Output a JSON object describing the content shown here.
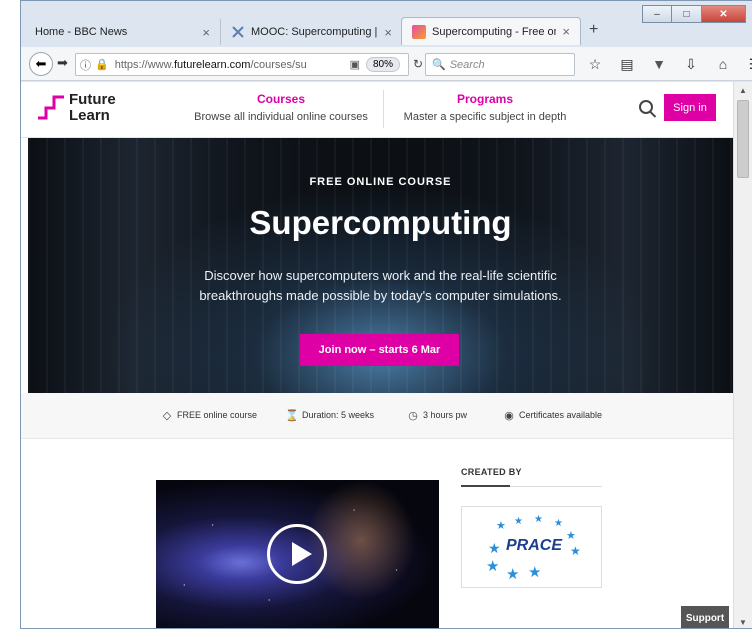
{
  "browser": {
    "tabs": [
      {
        "title": "Home - BBC News",
        "close": "×"
      },
      {
        "title": "MOOC: Supercomputing | ...",
        "close": "×"
      },
      {
        "title": "Supercomputing - Free onl...",
        "close": "×"
      }
    ],
    "new_tab": "+",
    "window_controls": {
      "minimize": "–",
      "maximize": "□",
      "close": "✕"
    },
    "url_prefix": "https://www.",
    "url_domain": "futurelearn.com",
    "url_path": "/courses/su",
    "zoom": "80%",
    "search_placeholder": "Search"
  },
  "site": {
    "logo_line1": "Future",
    "logo_line2": "Learn",
    "nav": [
      {
        "title": "Courses",
        "subtitle": "Browse all individual online courses"
      },
      {
        "title": "Programs",
        "subtitle": "Master a specific subject in depth"
      }
    ],
    "signin": "Sign in"
  },
  "hero": {
    "kicker": "FREE ONLINE COURSE",
    "title": "Supercomputing",
    "desc_line1": "Discover how supercomputers work and the real-life scientific",
    "desc_line2": "breakthroughs made possible by today's computer simulations.",
    "cta": "Join now – starts 6 Mar"
  },
  "info": [
    {
      "icon": "globe-icon",
      "label": "FREE online course"
    },
    {
      "icon": "hourglass-icon",
      "label": "Duration: 5 weeks"
    },
    {
      "icon": "clock-icon",
      "label": "3 hours pw"
    },
    {
      "icon": "certificate-icon",
      "label": "Certificates available"
    }
  ],
  "created_by": {
    "heading": "CREATED BY",
    "partner": "PRACE"
  },
  "support": "Support",
  "colors": {
    "brand": "#de00a5"
  }
}
